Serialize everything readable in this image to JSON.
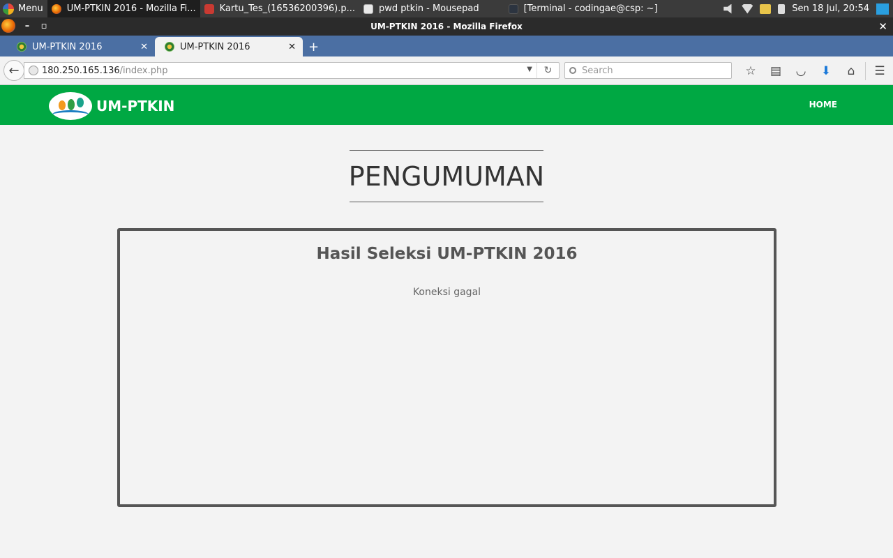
{
  "system_panel": {
    "menu_label": "Menu",
    "tasks": [
      {
        "label": "UM-PTKIN 2016 - Mozilla Fi...",
        "icon": "firefox-icon"
      },
      {
        "label": "Kartu_Tes_(16536200396).p...",
        "icon": "pdf-icon"
      },
      {
        "label": "pwd ptkin - Mousepad",
        "icon": "mousepad-icon"
      },
      {
        "label": "[Terminal - codingae@csp: ~]",
        "icon": "terminal-icon"
      }
    ],
    "clock": "Sen 18 Jul, 20:54"
  },
  "window": {
    "title": "UM-PTKIN 2016 - Mozilla Firefox"
  },
  "tabs": [
    {
      "label": "UM-PTKIN 2016",
      "active": false
    },
    {
      "label": "UM-PTKIN 2016",
      "active": true
    }
  ],
  "toolbar": {
    "url_host": "180.250.165.136",
    "url_path": "/index.php",
    "search_placeholder": "Search"
  },
  "site": {
    "brand": "UM-PTKIN",
    "nav_home": "HOME",
    "section_title": "PENGUMUMAN",
    "panel_title": "Hasil Seleksi UM-PTKIN 2016",
    "panel_message": "Koneksi gagal"
  },
  "colors": {
    "header_green": "#00a843",
    "tabstrip_blue": "#4b6fa3"
  }
}
